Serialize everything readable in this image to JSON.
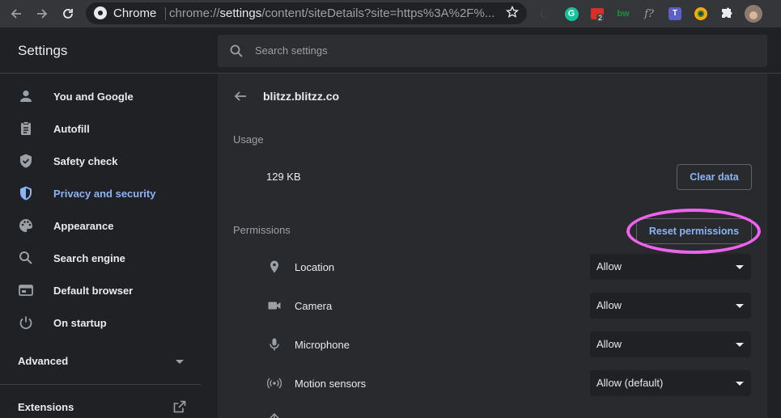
{
  "browser": {
    "tab_label": "Chrome",
    "url_prefix": "chrome://",
    "url_bold": "settings",
    "url_rest": "/content/siteDetails?site=https%3A%2F%...",
    "extensions": [
      {
        "icon": "moon-icon"
      },
      {
        "icon": "grammarly-icon",
        "text": "G"
      },
      {
        "icon": "todo-extension-icon",
        "badge": "2"
      },
      {
        "icon": "bw-extension-icon",
        "text": "bw"
      },
      {
        "icon": "fx-extension-icon",
        "text": "f?"
      },
      {
        "icon": "teams-icon",
        "text": "T"
      },
      {
        "icon": "color-picker-icon"
      },
      {
        "icon": "puzzle-icon"
      },
      {
        "icon": "profile-avatar"
      }
    ]
  },
  "header": {
    "title": "Settings",
    "search_placeholder": "Search settings"
  },
  "sidebar": {
    "items": [
      {
        "label": "You and Google",
        "icon": "person-icon"
      },
      {
        "label": "Autofill",
        "icon": "clipboard-icon"
      },
      {
        "label": "Safety check",
        "icon": "shield-check-icon"
      },
      {
        "label": "Privacy and security",
        "icon": "shield-icon",
        "active": true
      },
      {
        "label": "Appearance",
        "icon": "palette-icon"
      },
      {
        "label": "Search engine",
        "icon": "search-icon"
      },
      {
        "label": "Default browser",
        "icon": "browser-icon"
      },
      {
        "label": "On startup",
        "icon": "power-icon"
      }
    ],
    "advanced_label": "Advanced",
    "extensions_label": "Extensions"
  },
  "site": {
    "name": "blitzz.blitzz.co",
    "usage_heading": "Usage",
    "usage_value": "129 KB",
    "clear_data_label": "Clear data",
    "permissions_heading": "Permissions",
    "reset_permissions_label": "Reset permissions",
    "permissions": [
      {
        "label": "Location",
        "icon": "location-icon",
        "value": "Allow"
      },
      {
        "label": "Camera",
        "icon": "camera-icon",
        "value": "Allow"
      },
      {
        "label": "Microphone",
        "icon": "microphone-icon",
        "value": "Allow"
      },
      {
        "label": "Motion sensors",
        "icon": "motion-sensor-icon",
        "value": "Allow (default)"
      }
    ]
  },
  "colors": {
    "accent": "#8ab4f8",
    "highlight": "#ee62ee",
    "background": "#202124",
    "card": "#292a2d"
  }
}
